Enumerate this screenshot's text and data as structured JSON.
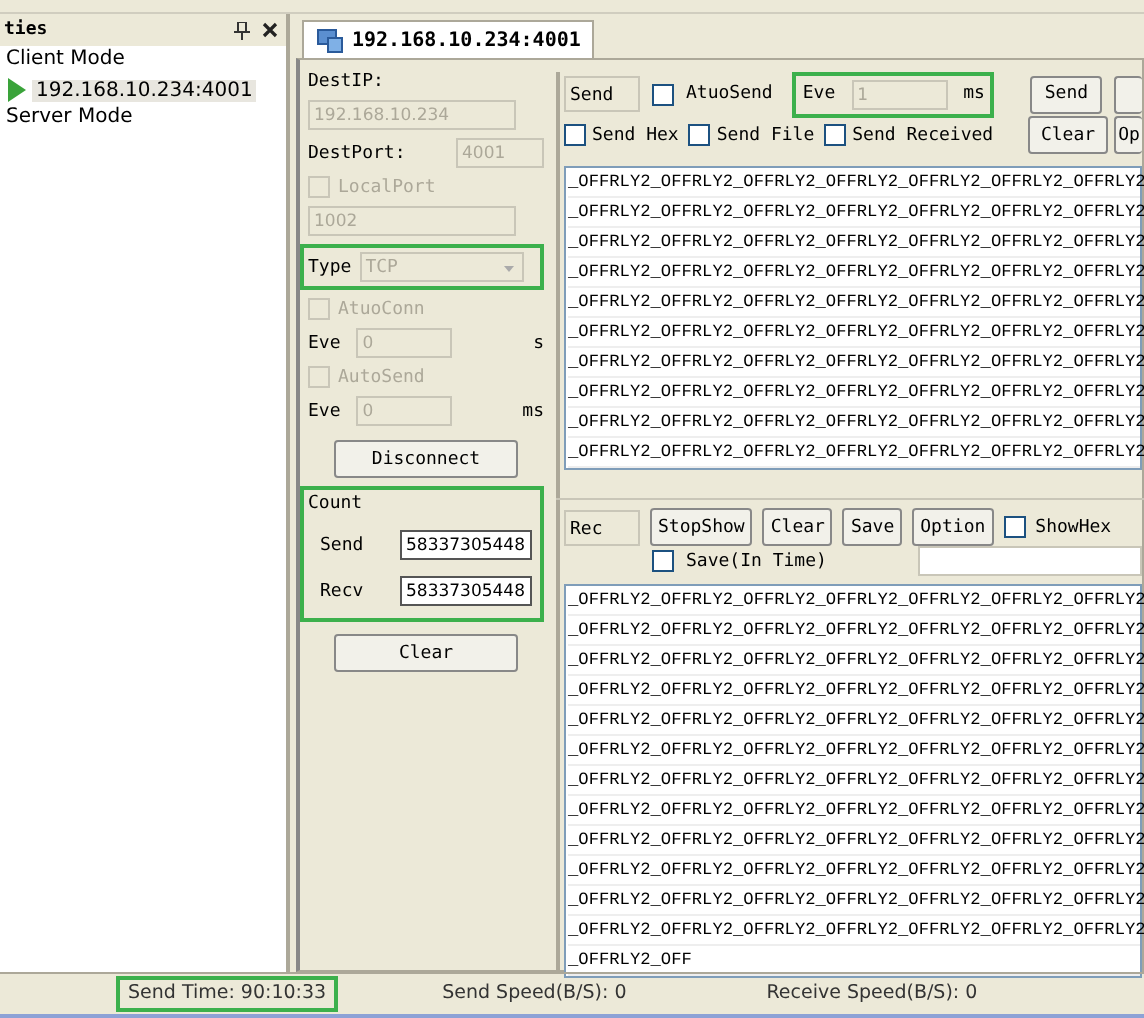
{
  "sidebar": {
    "title": "ties",
    "items": [
      {
        "label": "Client Mode",
        "children": [
          {
            "label": "192.168.10.234:4001",
            "selected": true
          }
        ]
      },
      {
        "label": "Server Mode"
      }
    ]
  },
  "tab": {
    "label": "192.168.10.234:4001",
    "selected": true
  },
  "connection": {
    "dest_ip_label": "DestIP:",
    "dest_ip": "192.168.10.234",
    "dest_port_label": "DestPort:",
    "dest_port": "4001",
    "local_port": {
      "label": "LocalPort",
      "checked": false,
      "value": "1002"
    },
    "type": {
      "label": "Type",
      "value": "TCP",
      "highlighted": true
    },
    "auto_conn": {
      "label": "AtuoConn",
      "checked": false,
      "eve_label": "Eve",
      "eve_value": "0",
      "unit": "s"
    },
    "auto_send": {
      "label": "AutoSend",
      "checked": false,
      "eve_label": "Eve",
      "eve_value": "0",
      "unit": "ms"
    },
    "disconnect": "Disconnect"
  },
  "count": {
    "title": "Count",
    "highlighted": true,
    "send_label": "Send",
    "send": "58337305448",
    "recv_label": "Recv",
    "recv": "58337305448",
    "clear": "Clear"
  },
  "send_panel": {
    "mode": "Send",
    "auto_send": {
      "label": "AtuoSend",
      "checked": false
    },
    "interval": {
      "label": "Eve",
      "value": "1",
      "unit": "ms",
      "highlighted": true
    },
    "send_button": "Send",
    "options": [
      {
        "label": "Send Hex",
        "checked": false
      },
      {
        "label": "Send File",
        "checked": false
      },
      {
        "label": "Send Received",
        "checked": false
      }
    ],
    "clear": "Clear",
    "open_button": "Op",
    "lines": [
      "_OFFRLY2_OFFRLY2_OFFRLY2_OFFRLY2_OFFRLY2_OFFRLY2_OFFRLY2",
      "_OFFRLY2_OFFRLY2_OFFRLY2_OFFRLY2_OFFRLY2_OFFRLY2_OFFRLY2",
      "_OFFRLY2_OFFRLY2_OFFRLY2_OFFRLY2_OFFRLY2_OFFRLY2_OFFRLY2",
      "_OFFRLY2_OFFRLY2_OFFRLY2_OFFRLY2_OFFRLY2_OFFRLY2_OFFRLY2",
      "_OFFRLY2_OFFRLY2_OFFRLY2_OFFRLY2_OFFRLY2_OFFRLY2_OFFRLY2",
      "_OFFRLY2_OFFRLY2_OFFRLY2_OFFRLY2_OFFRLY2_OFFRLY2_OFFRLY2",
      "_OFFRLY2_OFFRLY2_OFFRLY2_OFFRLY2_OFFRLY2_OFFRLY2_OFFRLY2",
      "_OFFRLY2_OFFRLY2_OFFRLY2_OFFRLY2_OFFRLY2_OFFRLY2_OFFRLY2",
      "_OFFRLY2_OFFRLY2_OFFRLY2_OFFRLY2_OFFRLY2_OFFRLY2_OFFRLY2",
      "_OFFRLY2_OFFRLY2_OFFRLY2_OFFRLY2_OFFRLY2_OFFRLY2_OFFRLY2"
    ]
  },
  "receive_panel": {
    "mode": "Rec",
    "buttons": [
      "StopShow",
      "Clear",
      "Save",
      "Option"
    ],
    "show_hex": {
      "label": "ShowHex",
      "checked": false
    },
    "save_in_time": {
      "label": "Save(In Time)",
      "checked": false
    },
    "lines": [
      "_OFFRLY2_OFFRLY2_OFFRLY2_OFFRLY2_OFFRLY2_OFFRLY2_OFFRLY2",
      "_OFFRLY2_OFFRLY2_OFFRLY2_OFFRLY2_OFFRLY2_OFFRLY2_OFFRLY2",
      "_OFFRLY2_OFFRLY2_OFFRLY2_OFFRLY2_OFFRLY2_OFFRLY2_OFFRLY2",
      "_OFFRLY2_OFFRLY2_OFFRLY2_OFFRLY2_OFFRLY2_OFFRLY2_OFFRLY2",
      "_OFFRLY2_OFFRLY2_OFFRLY2_OFFRLY2_OFFRLY2_OFFRLY2_OFFRLY2",
      "_OFFRLY2_OFFRLY2_OFFRLY2_OFFRLY2_OFFRLY2_OFFRLY2_OFFRLY2",
      "_OFFRLY2_OFFRLY2_OFFRLY2_OFFRLY2_OFFRLY2_OFFRLY2_OFFRLY2",
      "_OFFRLY2_OFFRLY2_OFFRLY2_OFFRLY2_OFFRLY2_OFFRLY2_OFFRLY2",
      "_OFFRLY2_OFFRLY2_OFFRLY2_OFFRLY2_OFFRLY2_OFFRLY2_OFFRLY2",
      "_OFFRLY2_OFFRLY2_OFFRLY2_OFFRLY2_OFFRLY2_OFFRLY2_OFFRLY2",
      "_OFFRLY2_OFFRLY2_OFFRLY2_OFFRLY2_OFFRLY2_OFFRLY2_OFFRLY2",
      "_OFFRLY2_OFFRLY2_OFFRLY2_OFFRLY2_OFFRLY2_OFFRLY2_OFFRLY2",
      "_OFFRLY2_OFF"
    ]
  },
  "status_bar": [
    {
      "text": "Send Time: 90:10:33",
      "highlighted": true
    },
    {
      "text": "Send Speed(B/S): 0",
      "highlighted": false
    },
    {
      "text": "Receive Speed(B/S): 0",
      "highlighted": false
    }
  ]
}
